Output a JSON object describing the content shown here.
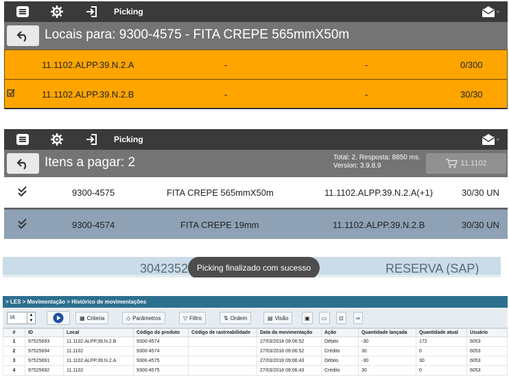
{
  "panel1": {
    "topbar": {
      "title": "Picking",
      "env_badge": "»"
    },
    "header": {
      "title": "Locais para: 9300-4575 - FITA CREPE 565mmX50m"
    },
    "rows": [
      {
        "checked": false,
        "location": "11.1102.ALPP.39.N.2.A",
        "col2": "-",
        "col3": "-",
        "qty": "0/300"
      },
      {
        "checked": true,
        "location": "11.1102.ALPP.39.N.2.B",
        "col2": "-",
        "col3": "-",
        "qty": "30/30"
      }
    ]
  },
  "panel2": {
    "topbar": {
      "title": "Picking",
      "env_badge": "»"
    },
    "header": {
      "title": "Itens a pagar: 2",
      "stats_line1": "Total: 2. Resposta: 8850 ms.",
      "stats_line2": "Version: 3.9.8.9",
      "cart_label": "11.1102"
    },
    "rows": [
      {
        "code": "9300-4575",
        "desc": "FITA CREPE 565mmX50m",
        "location": "11.1102.ALPP.39.N.2.A(+1)",
        "qty": "30/30 UN"
      },
      {
        "code": "9300-4574",
        "desc": "FITA CREPE 19mm",
        "location": "11.1102.ALPP.39.N.2.B",
        "qty": "30/30 UN"
      }
    ]
  },
  "toast": {
    "message": "Picking finalizado com sucesso",
    "bg_left": "30423529",
    "bg_right": "RESERVA (SAP)"
  },
  "history": {
    "breadcrumb": "> LES > Movimentação > Histórico de movimentações",
    "page_size": "16",
    "toolbar": {
      "criteria": "Criteria",
      "parametros": "Parâmetros",
      "filtro": "Filtro",
      "ordem": "Ordem",
      "visao": "Visão"
    },
    "columns": [
      "#",
      "ID",
      "Local",
      "Código do produto",
      "Código de rastreabilidade",
      "Data da movimentação",
      "Ação",
      "Quantidade lançada",
      "Quantidade atual",
      "Usuário"
    ],
    "rows": [
      [
        "1",
        "97525693",
        "11.1102.ALPP.39.N.2.B",
        "9300-4574",
        "",
        "27/03/2018 09:06:52",
        "Débito",
        "-30",
        "172",
        "6053"
      ],
      [
        "2",
        "97525694",
        "11.1102",
        "9300-4574",
        "",
        "27/03/2018 09:06:52",
        "Crédito",
        "30",
        "0",
        "6053"
      ],
      [
        "3",
        "97525691",
        "11.1102.ALPP.39.N.2.A",
        "9300-4575",
        "",
        "27/03/2018 09:06:43",
        "Débito",
        "-30",
        "30",
        "6053"
      ],
      [
        "4",
        "97525692",
        "11.1102",
        "9300-4575",
        "",
        "27/03/2018 09:06:43",
        "Crédito",
        "30",
        "0",
        "6053"
      ]
    ]
  },
  "colors": {
    "topbar": "#3a3a3a",
    "header": "#747474",
    "orange_row": "#ffa500",
    "selected_row": "#8ea1b5",
    "history_bar": "#2d6f8f"
  }
}
